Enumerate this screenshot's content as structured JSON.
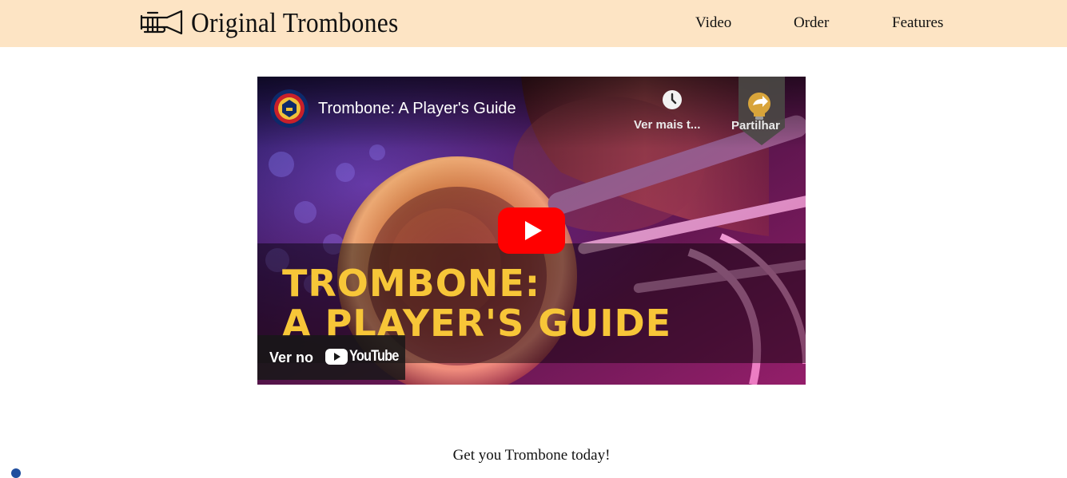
{
  "header": {
    "logo_icon": "trumpet-icon",
    "brand": "Original Trombones",
    "nav": [
      {
        "label": "Video"
      },
      {
        "label": "Order"
      },
      {
        "label": "Features"
      }
    ]
  },
  "video": {
    "title": "Trombone: A Player's Guide",
    "channel_icon": "channel-crest-icon",
    "watch_later": {
      "icon": "clock-icon",
      "label": "Ver mais t..."
    },
    "share": {
      "icon": "share-arrow-icon",
      "label": "Partilhar"
    },
    "poster_title": [
      "TROMBONE:",
      "A PLAYER'S GUIDE"
    ],
    "play_icon": "play-icon",
    "watch_on": {
      "label": "Ver no",
      "logo": "youtube-logo-icon",
      "brand": "YouTube"
    },
    "colors": {
      "poster_title": "#f7c638",
      "play_button": "#ff0000"
    }
  },
  "cta": {
    "text": "Get you Trombone today!"
  },
  "colors": {
    "header_bg": "#fde4c4",
    "page_bg": "#ffffff"
  }
}
